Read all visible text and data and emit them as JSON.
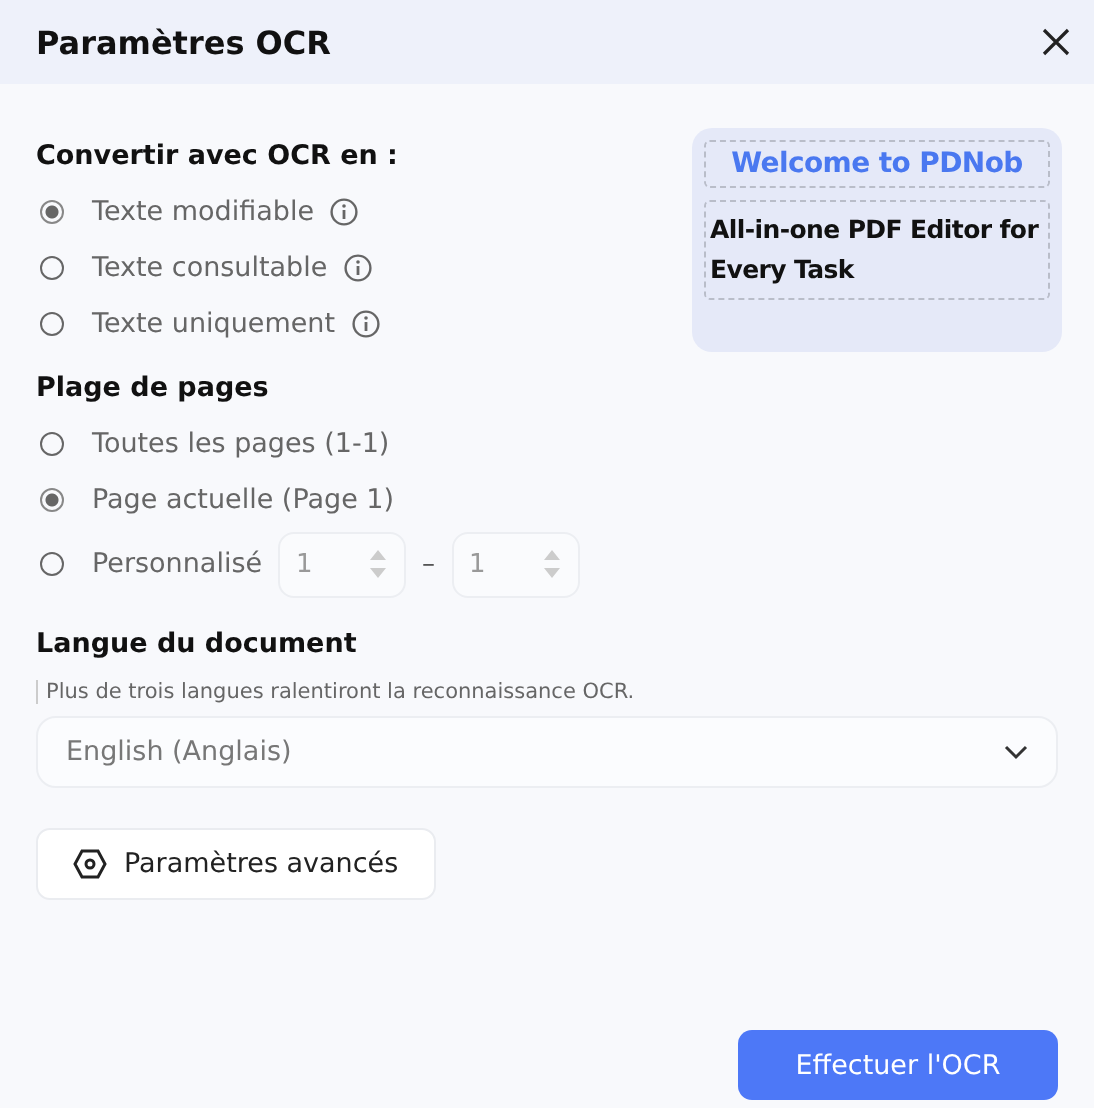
{
  "title": "Paramètres OCR",
  "convert": {
    "heading": "Convertir avec OCR en :",
    "options": [
      {
        "label": "Texte modifiable",
        "selected": true
      },
      {
        "label": "Texte consultable",
        "selected": false
      },
      {
        "label": "Texte uniquement",
        "selected": false
      }
    ]
  },
  "banner": {
    "headline": "Welcome to PDNob",
    "tagline": "All-in-one PDF Editor for Every Task"
  },
  "page_range": {
    "heading": "Plage de pages",
    "options": [
      {
        "kind": "plain",
        "label": "Toutes les pages (1-1)",
        "selected": false
      },
      {
        "kind": "plain",
        "label": "Page actuelle (Page 1)",
        "selected": true
      },
      {
        "kind": "custom",
        "label": "Personnalisé",
        "selected": false,
        "from": "1",
        "separator": "–",
        "to": "1",
        "disabled": true
      }
    ]
  },
  "language": {
    "heading": "Langue du document",
    "hint": "Plus de trois langues ralentiront la reconnaissance OCR.",
    "value": "English (Anglais)"
  },
  "advanced_button": "Paramètres avancés",
  "submit_button": "Effectuer l'OCR"
}
